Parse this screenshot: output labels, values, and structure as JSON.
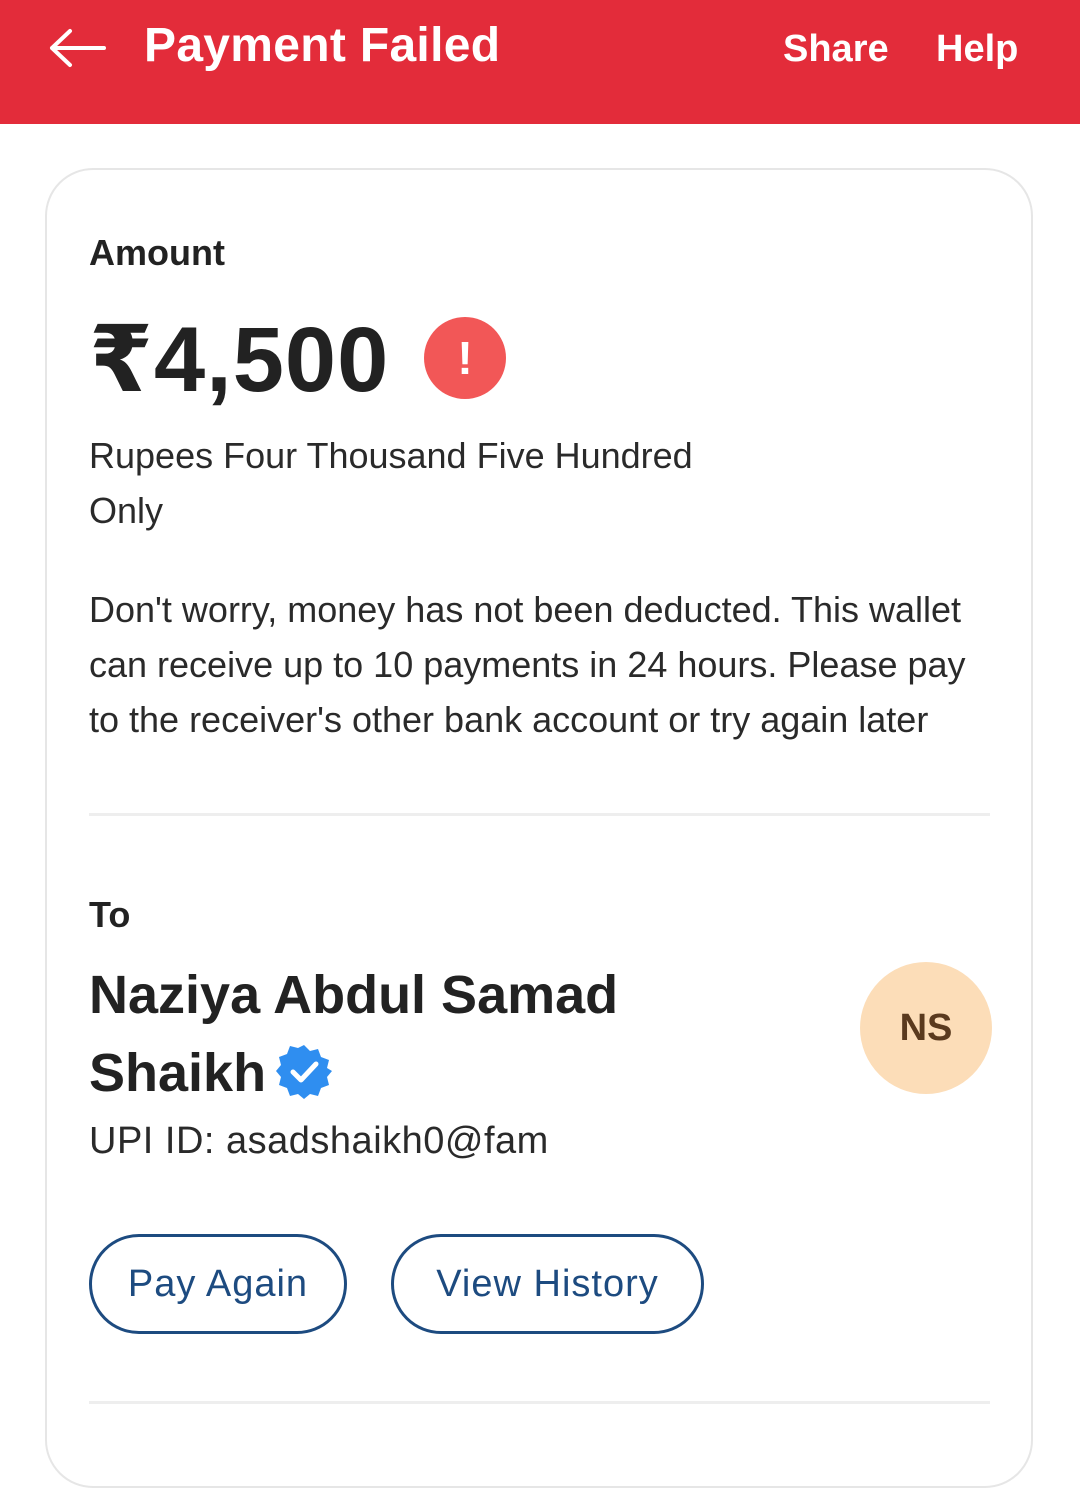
{
  "header": {
    "title": "Payment Failed",
    "share_label": "Share",
    "help_label": "Help",
    "background_color": "#E32C3A"
  },
  "amount_section": {
    "label": "Amount",
    "value": "₹4,500",
    "status_icon": "exclamation-icon",
    "words_line1": "Rupees Four Thousand Five Hundred",
    "words_line2": "Only",
    "message": "Don't worry, money has not been deducted. This wallet can receive up to 10 payments in 24 hours. Please pay to the receiver's other bank account or try again later"
  },
  "recipient": {
    "label": "To",
    "name_line1": "Naziya Abdul Samad",
    "name_line2": "Shaikh",
    "verified_icon": "verified-badge-icon",
    "avatar_initials": "NS",
    "upi_id": "UPI ID: asadshaikh0@fam"
  },
  "actions": {
    "pay_again_label": "Pay Again",
    "view_history_label": "View History",
    "accent_color": "#1D4B80"
  }
}
